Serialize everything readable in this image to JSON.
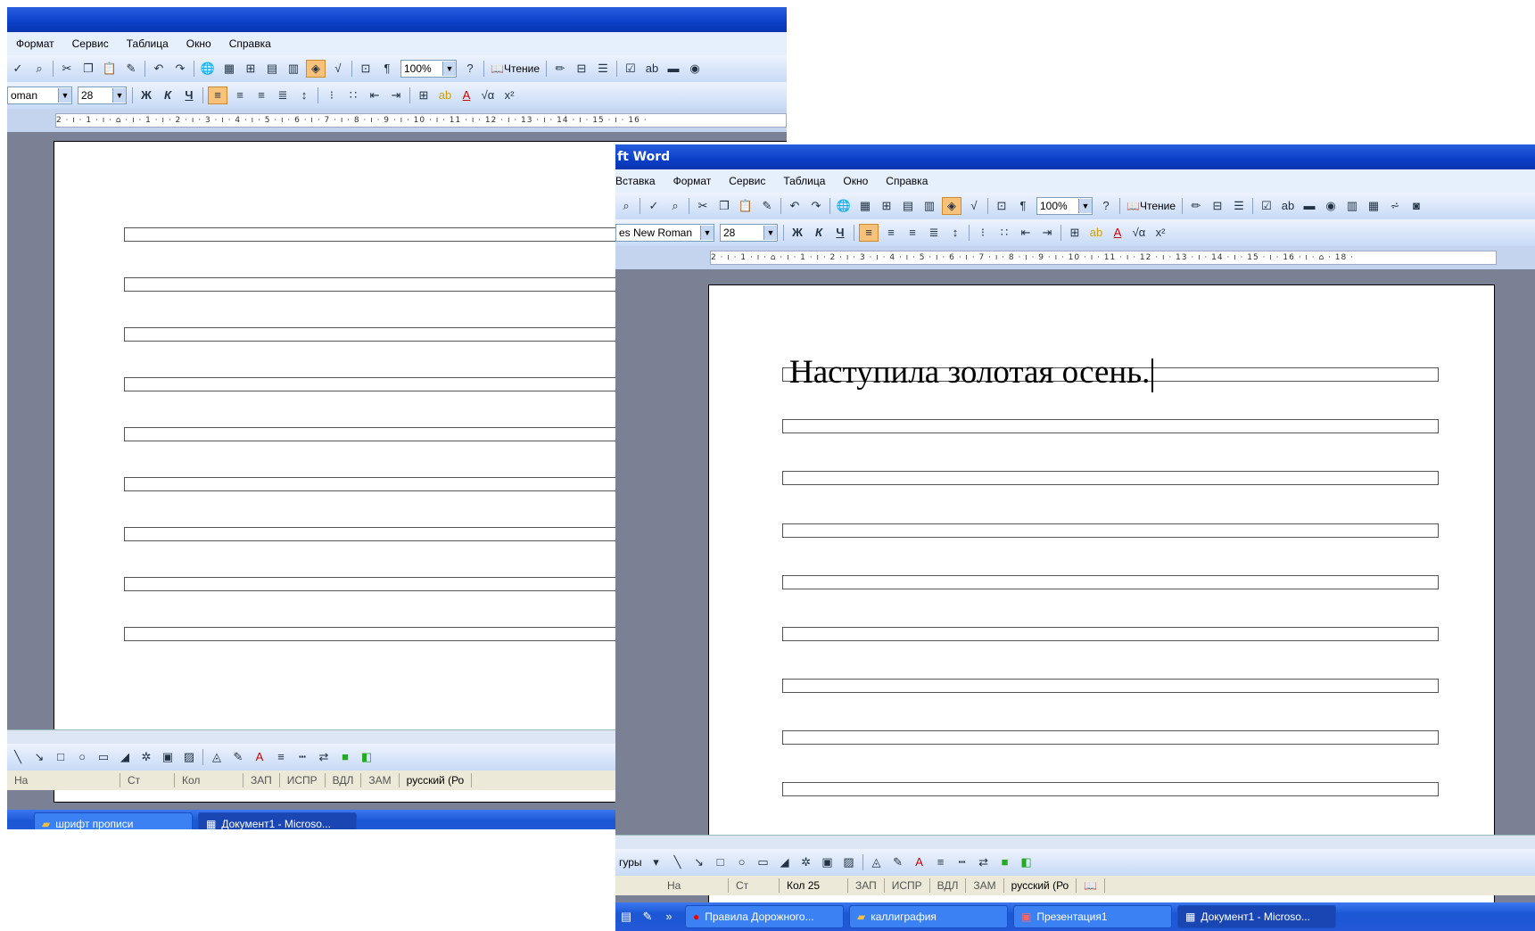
{
  "win1": {
    "title": "",
    "menu": [
      "Формат",
      "Сервис",
      "Таблица",
      "Окно",
      "Справка"
    ],
    "zoom": "100%",
    "reading_label": "Чтение",
    "font_name": "oman",
    "font_size": "28",
    "ruler_text": "2 · ı · 1 · ı · ⌂ · ı · 1 · ı · 2 · ı · 3 · ı · 4 · ı · 5 · ı · 6 · ı · 7 · ı · 8 · ı · 9 · ı · 10 · ı · 11 · ı · 12 · ı · 13 · ı · 14 · ı · 15 · ı · 16 ·",
    "status": [
      "На",
      "Ст",
      "Кол",
      "ЗАП",
      "ИСПР",
      "ВДЛ",
      "ЗАМ",
      "русский (Ро"
    ],
    "taskbar": [
      {
        "label": "шрифт прописи",
        "icon": "folder-icon"
      },
      {
        "label": "Документ1 - Microso...",
        "icon": "word-icon"
      }
    ]
  },
  "win2": {
    "title": "ft Word",
    "menu": [
      "Вставка",
      "Формат",
      "Сервис",
      "Таблица",
      "Окно",
      "Справка"
    ],
    "zoom": "100%",
    "reading_label": "Чтение",
    "font_name": "es New Roman",
    "font_size": "28",
    "ruler_text": "2 · ı · 1 · ı · ⌂ · ı · 1 · ı · 2 · ı · 3 · ı · 4 · ı · 5 · ı · 6 · ı · 7 · ı · 8 · ı · 9 · ı · 10 · ı · 11 · ı · 12 · ı · 13 · ı · 14 · ı · 15 · ı · 16 · ı · ⌂ · 18 ·",
    "page_text": "Наступила золотая осень.",
    "draw_label": "гуры",
    "status": [
      "На",
      "Ст",
      "Кол 25",
      "ЗАП",
      "ИСПР",
      "ВДЛ",
      "ЗАМ",
      "русский (Ро"
    ],
    "taskbar": [
      {
        "label": "Правила Дорожного...",
        "icon": "opera-icon"
      },
      {
        "label": "каллиграфия",
        "icon": "folder-icon"
      },
      {
        "label": "Презентация1",
        "icon": "powerpoint-icon"
      },
      {
        "label": "Документ1 - Microso...",
        "icon": "word-icon"
      }
    ]
  },
  "colors": {
    "titlebar": "#0b3fc7",
    "accent": "#f8c27a",
    "workspace": "#7a8194"
  }
}
